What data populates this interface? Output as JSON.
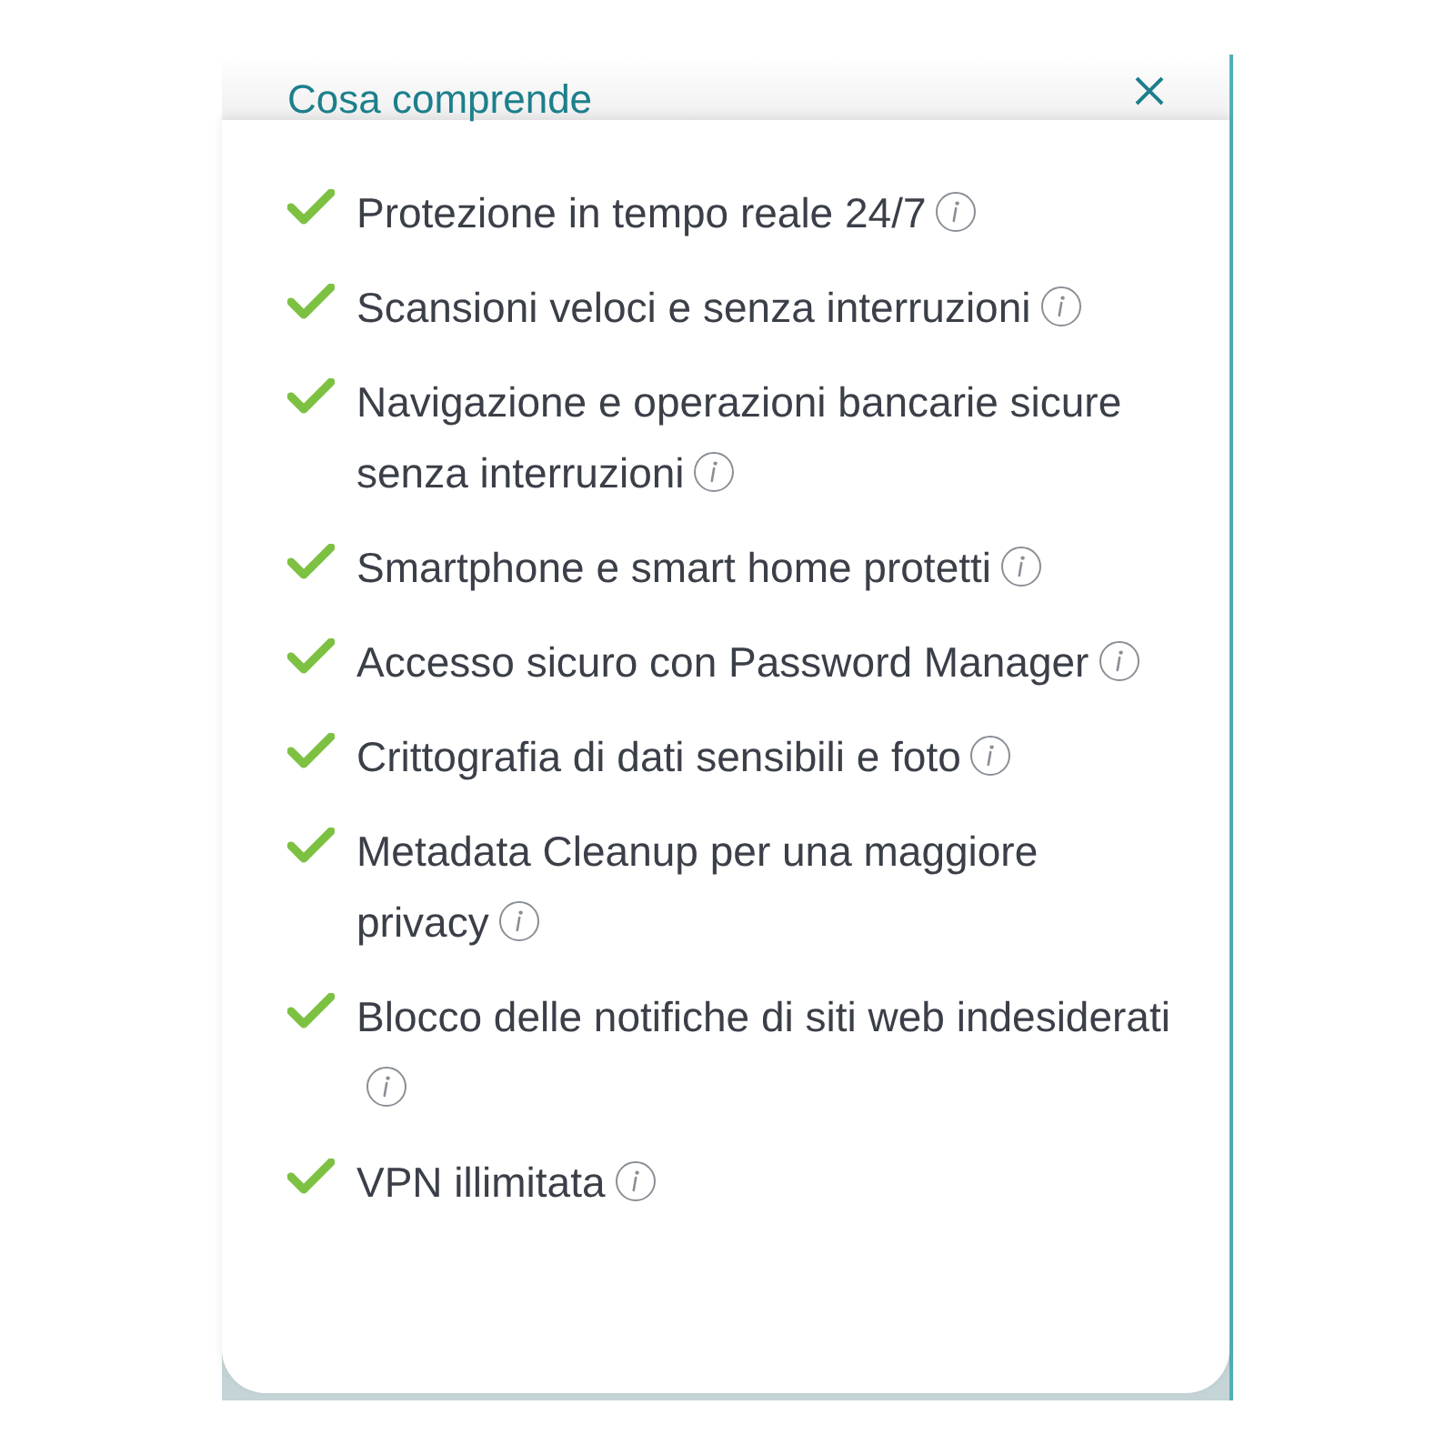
{
  "title": "Cosa comprende",
  "features": [
    {
      "text": "Protezione in tempo reale 24/7"
    },
    {
      "text": "Scansioni veloci e senza interruzioni"
    },
    {
      "text": "Navigazione e operazioni bancarie sicure senza interruzioni"
    },
    {
      "text": "Smartphone e smart home protetti"
    },
    {
      "text": "Accesso sicuro con Password Manager"
    },
    {
      "text": "Crittografia di dati sensibili e foto"
    },
    {
      "text": "Metadata Cleanup per una maggiore privacy"
    },
    {
      "text": "Blocco delle notifiche di siti web indesiderati"
    },
    {
      "text": "VPN illimitata"
    }
  ]
}
